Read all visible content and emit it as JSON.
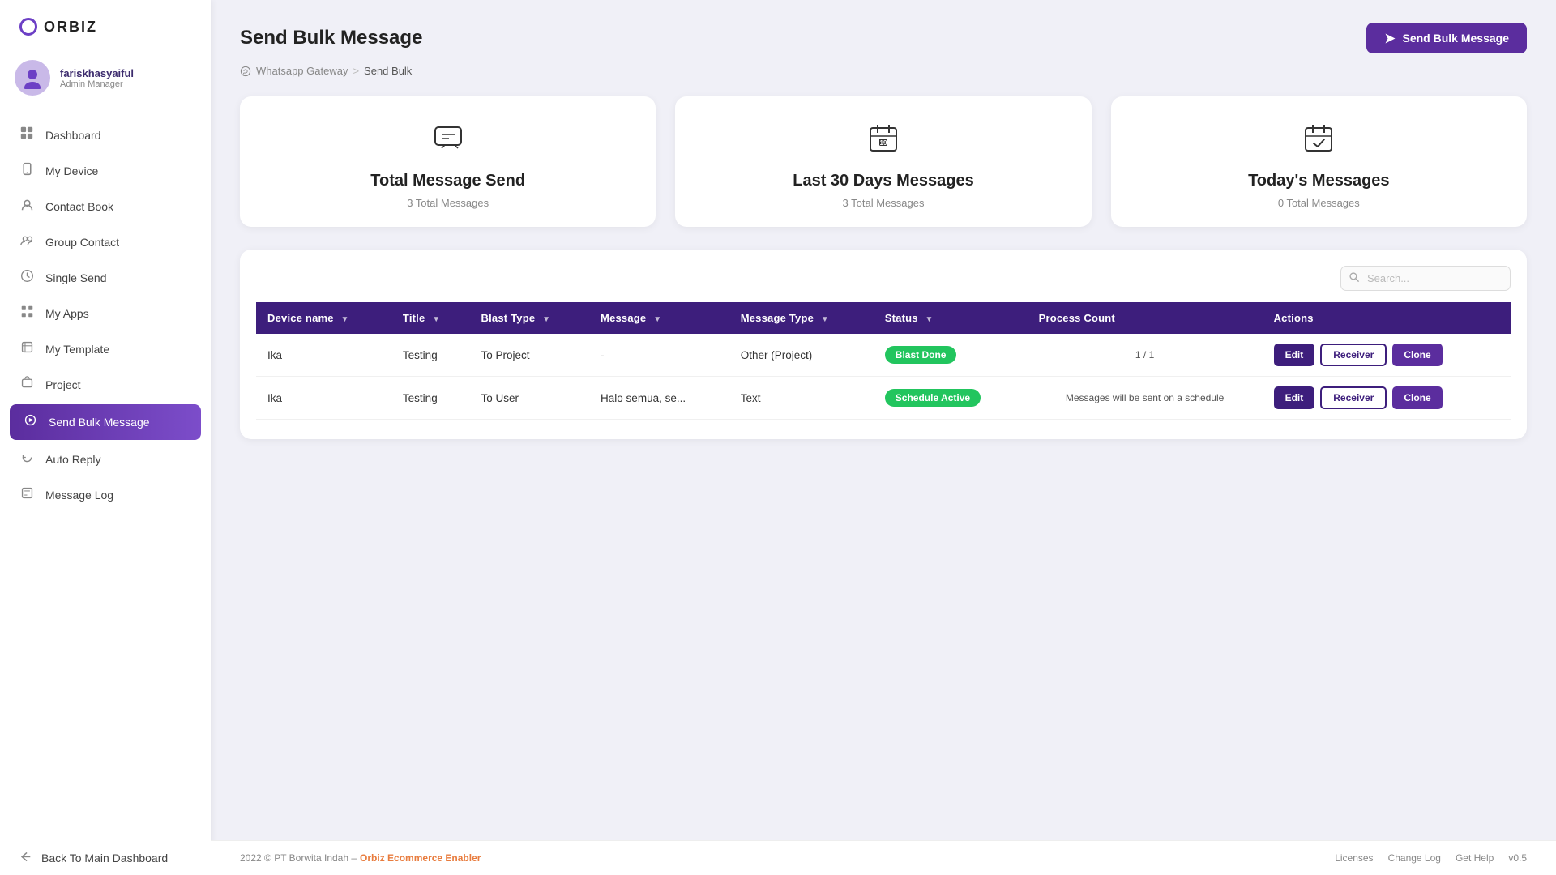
{
  "logo": {
    "text": "ORBIZ"
  },
  "user": {
    "name": "fariskhasyaiful",
    "role": "Admin Manager",
    "avatar_emoji": "👤"
  },
  "sidebar": {
    "items": [
      {
        "id": "dashboard",
        "label": "Dashboard",
        "icon": "📊"
      },
      {
        "id": "my-device",
        "label": "My Device",
        "icon": "📱"
      },
      {
        "id": "contact-book",
        "label": "Contact Book",
        "icon": "👤"
      },
      {
        "id": "group-contact",
        "label": "Group Contact",
        "icon": "👥"
      },
      {
        "id": "single-send",
        "label": "Single Send",
        "icon": "🔗"
      },
      {
        "id": "my-apps",
        "label": "My Apps",
        "icon": "🧩"
      },
      {
        "id": "my-template",
        "label": "My Template",
        "icon": "📋"
      },
      {
        "id": "project",
        "label": "Project",
        "icon": "🗂️"
      },
      {
        "id": "send-bulk-message",
        "label": "Send Bulk Message",
        "icon": "🚀",
        "active": true
      },
      {
        "id": "auto-reply",
        "label": "Auto Reply",
        "icon": "🔄"
      },
      {
        "id": "message-log",
        "label": "Message Log",
        "icon": "🗓️"
      }
    ],
    "back_label": "Back To Main Dashboard",
    "back_icon": "↩"
  },
  "page": {
    "title": "Send Bulk Message",
    "breadcrumb": {
      "parent": "Whatsapp Gateway",
      "separator": ">",
      "current": "Send Bulk"
    }
  },
  "send_bulk_button": "Send Bulk Message",
  "stats": [
    {
      "id": "total-message-send",
      "icon": "💬",
      "title": "Total Message Send",
      "subtitle": "3 Total Messages"
    },
    {
      "id": "last-30-days",
      "icon": "📅",
      "title": "Last 30 Days Messages",
      "subtitle": "3 Total Messages"
    },
    {
      "id": "todays-messages",
      "icon": "📆",
      "title": "Today's Messages",
      "subtitle": "0 Total Messages"
    }
  ],
  "table": {
    "search_placeholder": "Search...",
    "columns": [
      "Device name",
      "Title",
      "Blast Type",
      "Message",
      "Message Type",
      "Status",
      "Process Count",
      "Actions"
    ],
    "rows": [
      {
        "device_name": "Ika",
        "title": "Testing",
        "blast_type": "To Project",
        "message": "-",
        "message_type": "Other (Project)",
        "status": "Blast Done",
        "status_class": "badge-blast-done",
        "process_count": "1 / 1",
        "actions": [
          "Edit",
          "Receiver",
          "Clone"
        ]
      },
      {
        "device_name": "Ika",
        "title": "Testing",
        "blast_type": "To User",
        "message": "Halo semua, se...",
        "message_type": "Text",
        "status": "Schedule Active",
        "status_class": "badge-schedule-active",
        "process_count": "Messages will be sent on a schedule",
        "actions": [
          "Edit",
          "Receiver",
          "Clone"
        ]
      }
    ]
  },
  "footer": {
    "copyright": "2022 © PT Borwita Indah –",
    "brand_link": "Orbiz Ecommerce Enabler",
    "links": [
      "Licenses",
      "Change Log",
      "Get Help"
    ],
    "version": "v0.5"
  }
}
